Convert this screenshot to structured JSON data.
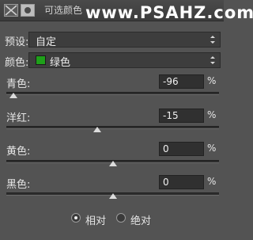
{
  "header": {
    "title": "可选颜色",
    "watermark": "www.PSAHZ.com"
  },
  "preset": {
    "label": "预设:",
    "value": "自定"
  },
  "color": {
    "label": "颜色:",
    "value": "绿色",
    "swatch": "#1fa01a"
  },
  "sliders": [
    {
      "label": "青色:",
      "value": "-96",
      "unit": "%",
      "level_percent": -96
    },
    {
      "label": "洋红:",
      "value": "-15",
      "unit": "%",
      "level_percent": -15
    },
    {
      "label": "黄色:",
      "value": "0",
      "unit": "%",
      "level_percent": 0
    },
    {
      "label": "黑色:",
      "value": "0",
      "unit": "%",
      "level_percent": 0
    }
  ],
  "mode": {
    "options": [
      {
        "label": "相对",
        "selected": true
      },
      {
        "label": "绝对",
        "selected": false
      }
    ]
  }
}
